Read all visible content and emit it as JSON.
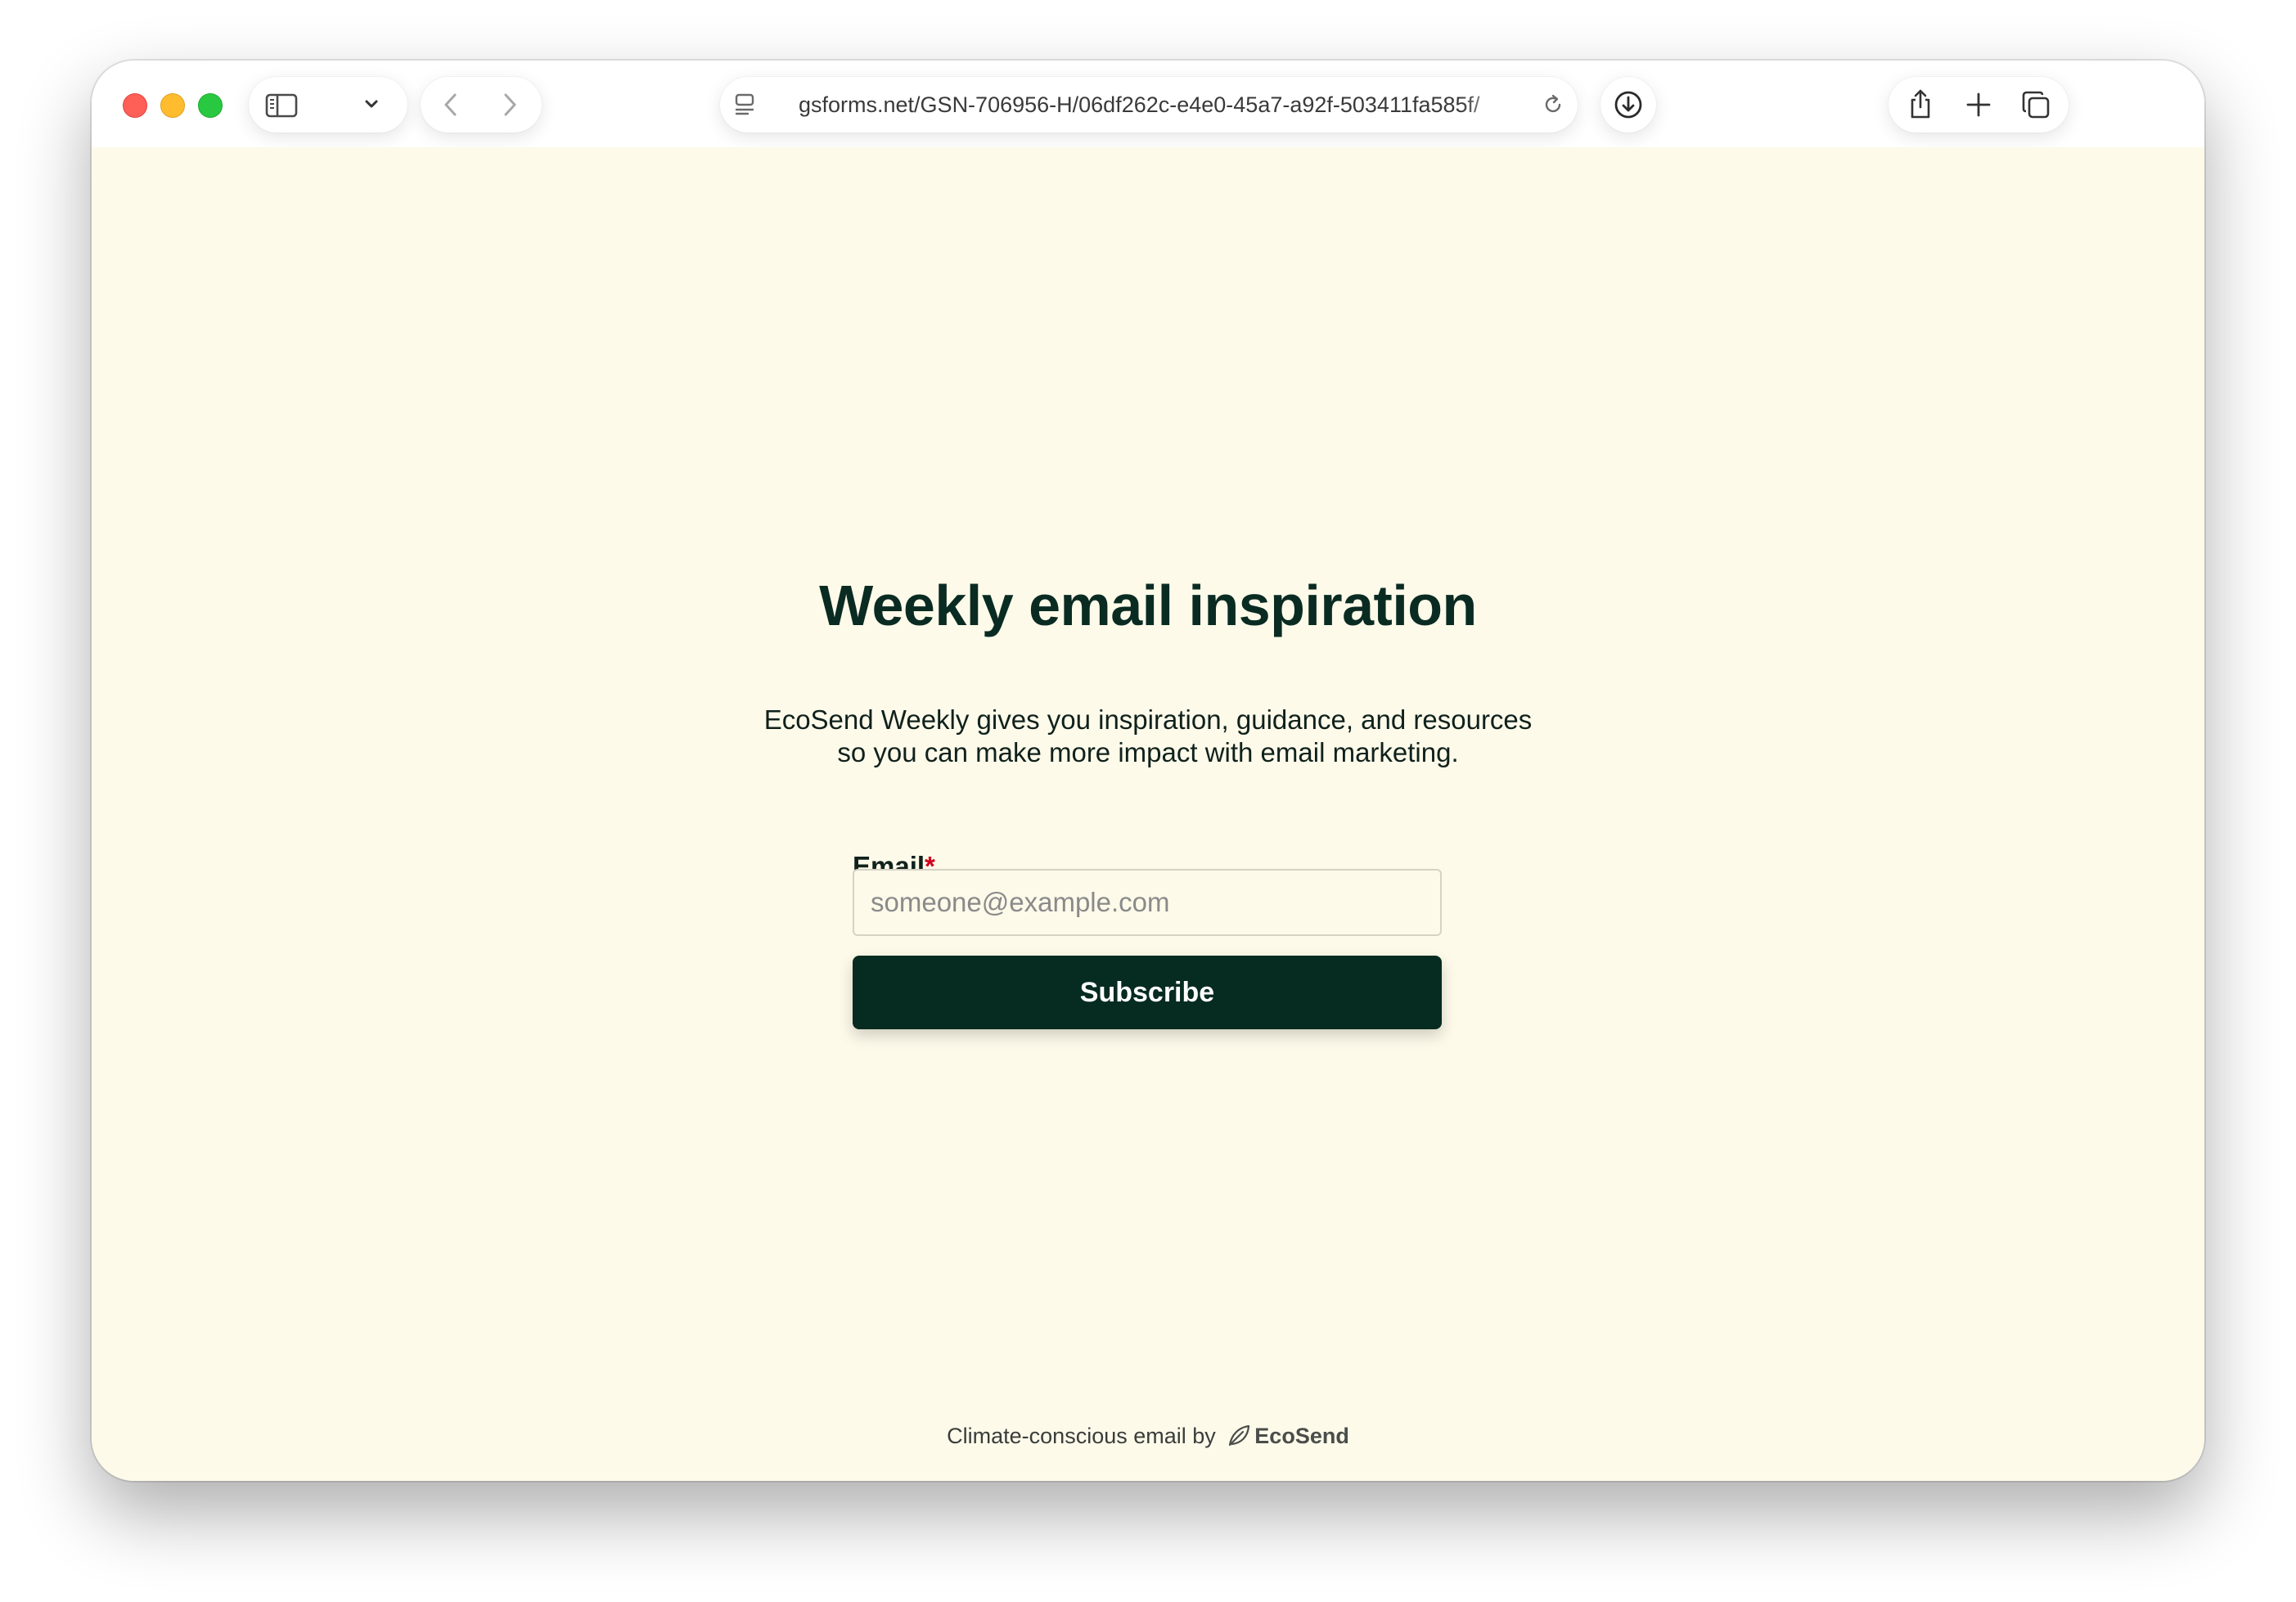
{
  "browser": {
    "url": "gsforms.net/GSN-706956-H/06df262c-e4e0-45a7-a92f-503411fa585f/",
    "icons": [
      "sidebar-icon",
      "chevron-down-icon",
      "back-icon",
      "forward-icon",
      "page-menu-icon",
      "reload-icon",
      "download-icon",
      "share-icon",
      "new-tab-icon",
      "tabs-overview-icon"
    ]
  },
  "form": {
    "title": "Weekly email inspiration",
    "description_line1": "EcoSend Weekly gives you inspiration, guidance, and resources",
    "description_line2": "so you can make more impact with email marketing.",
    "email_label": "Email",
    "required_marker": "*",
    "email_placeholder": "someone@example.com",
    "email_value": "",
    "submit_label": "Subscribe"
  },
  "footer": {
    "text": "Climate-conscious email by",
    "brand": "EcoSend"
  },
  "colors": {
    "page_background": "#fdfaea",
    "heading": "#0a2b22",
    "button": "#062b20",
    "required": "#d0021b"
  }
}
